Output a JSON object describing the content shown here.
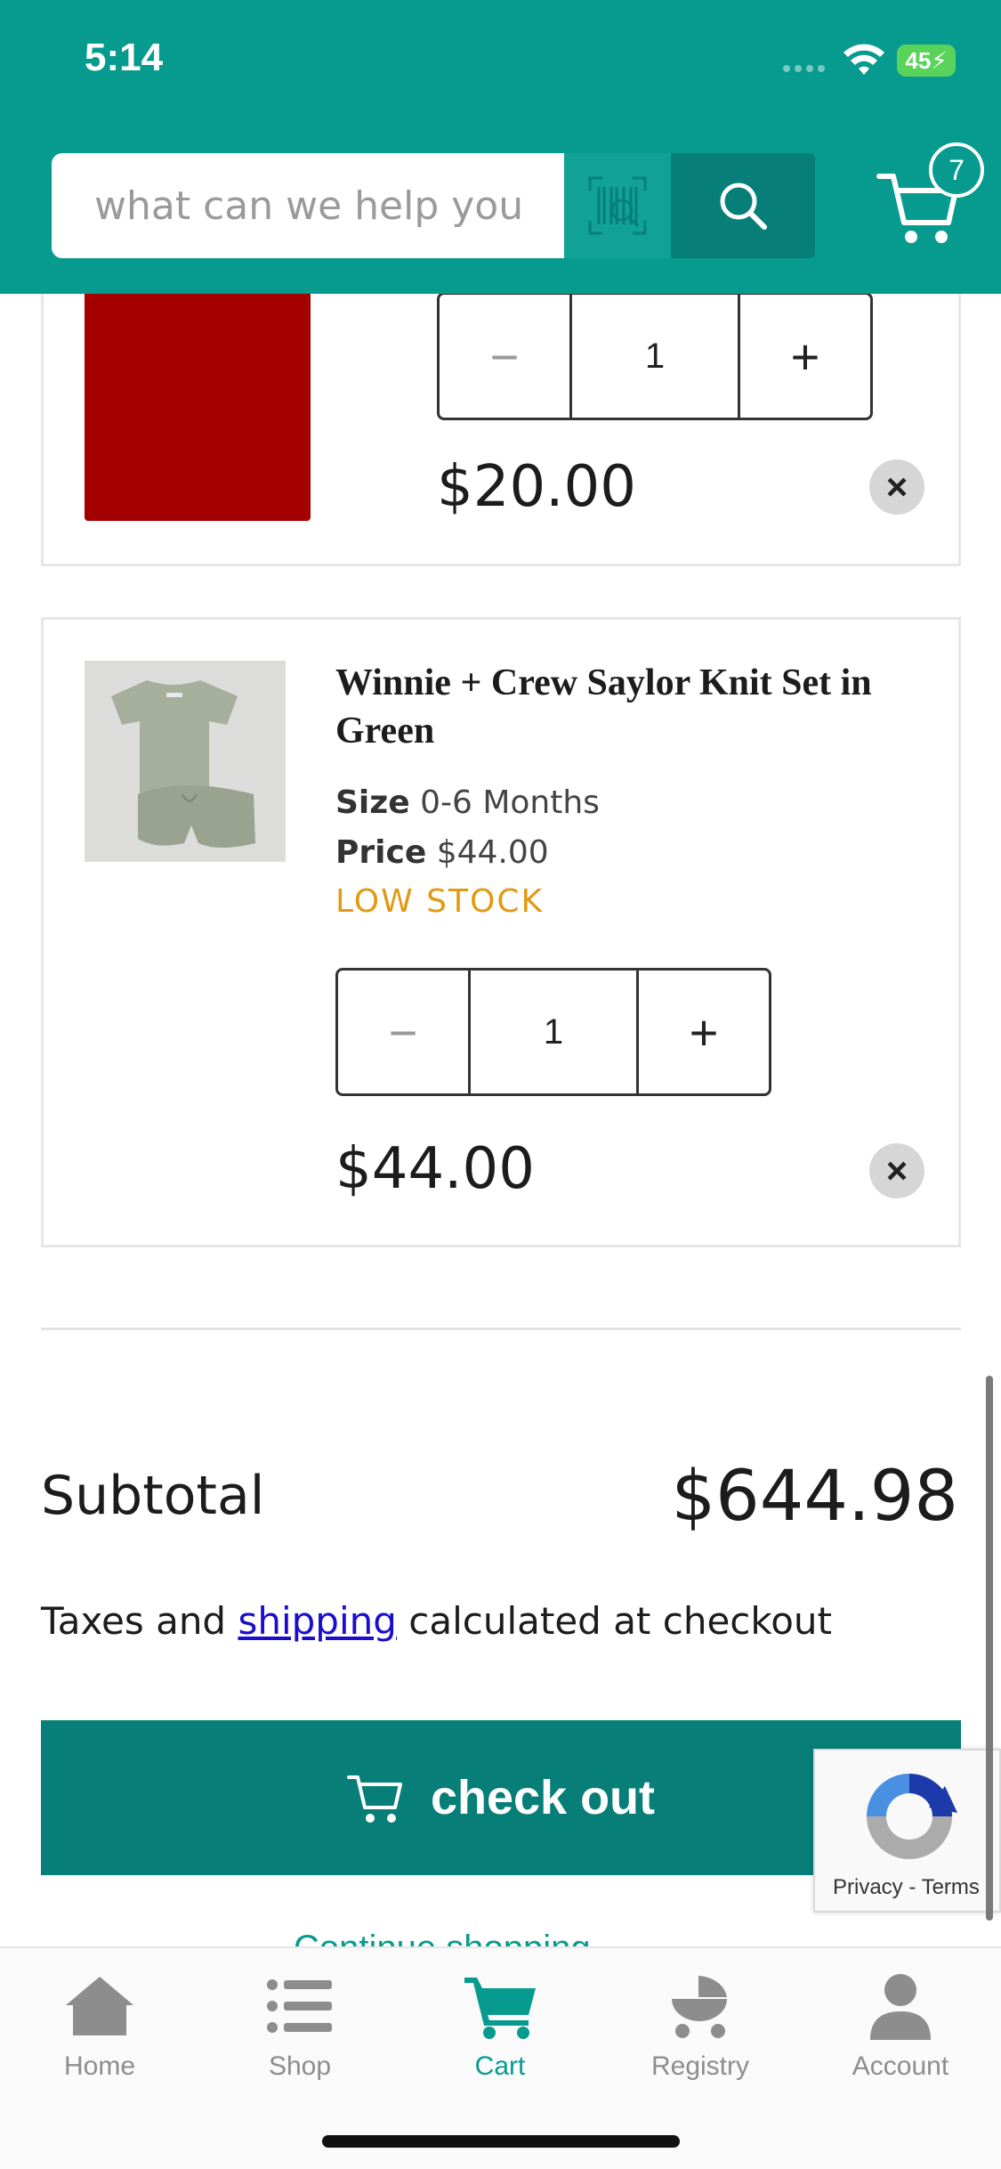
{
  "status_bar": {
    "time": "5:14",
    "battery": "45"
  },
  "header": {
    "search_placeholder": "what can we help you",
    "cart_count": "7"
  },
  "cart_items": [
    {
      "quantity": "1",
      "line_price": "$20.00",
      "swatch_color": "#a50000"
    },
    {
      "name": "Winnie + Crew Saylor Knit Set in Green",
      "size_label": "Size",
      "size_value": "0-6 Months",
      "price_label": "Price",
      "price_value": "$44.00",
      "stock_status": "LOW STOCK",
      "quantity": "1",
      "line_price": "$44.00"
    }
  ],
  "summary": {
    "subtotal_label": "Subtotal",
    "subtotal_value": "$644.98",
    "tax_prefix": "Taxes and ",
    "tax_link": "shipping",
    "tax_suffix": " calculated at checkout",
    "checkout_label": "check out",
    "continue_label": "Continue shopping"
  },
  "recaptcha": {
    "links": "Privacy - Terms"
  },
  "tabbar": {
    "items": [
      {
        "label": "Home",
        "icon": "home-icon"
      },
      {
        "label": "Shop",
        "icon": "list-icon"
      },
      {
        "label": "Cart",
        "icon": "cart-icon",
        "active": true
      },
      {
        "label": "Registry",
        "icon": "stroller-icon"
      },
      {
        "label": "Account",
        "icon": "person-icon"
      }
    ]
  },
  "colors": {
    "brand_teal": "#079b8f",
    "dark_teal": "#077f78",
    "low_stock": "#e29a12"
  }
}
